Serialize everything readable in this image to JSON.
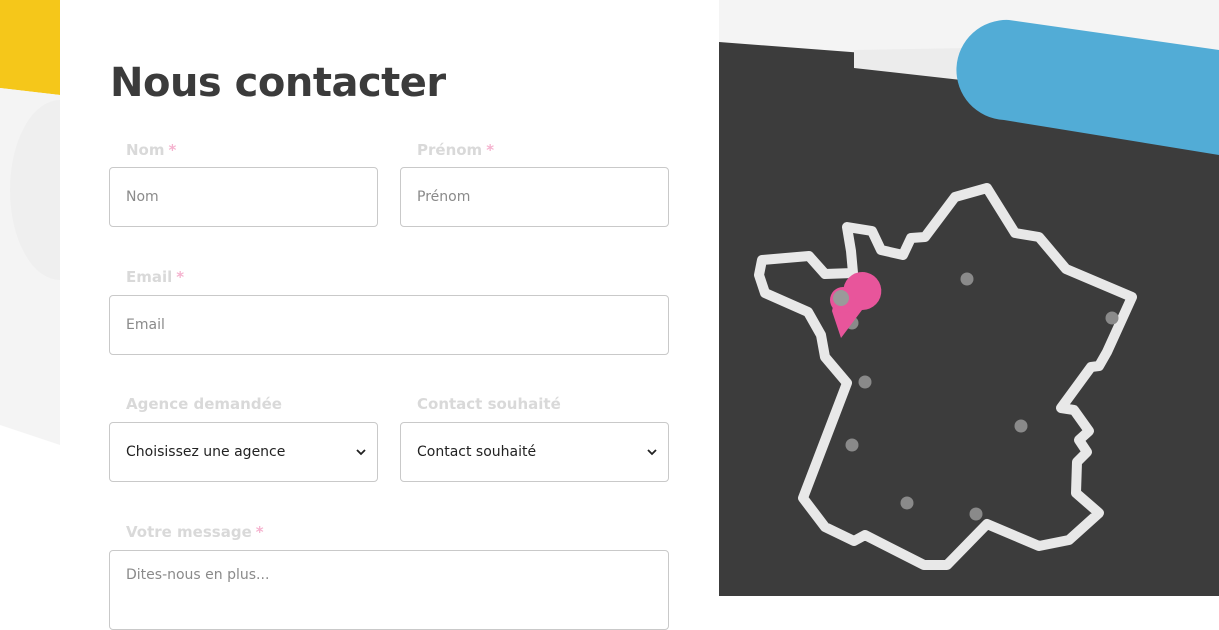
{
  "form": {
    "title": "Nous contacter",
    "required_mark": "*",
    "nom": {
      "label": "Nom",
      "placeholder": "Nom"
    },
    "prenom": {
      "label": "Prénom",
      "placeholder": "Prénom"
    },
    "email": {
      "label": "Email",
      "placeholder": "Email"
    },
    "agence": {
      "label": "Agence demandée",
      "value": "Choisissez une agence"
    },
    "contact": {
      "label": "Contact souhaité",
      "value": "Contact souhaité"
    },
    "message": {
      "label": "Votre message",
      "placeholder": "Dites-nous en plus..."
    }
  },
  "map": {
    "icon": "france-map-icon",
    "pin_icon": "location-pin-icon"
  },
  "colors": {
    "accent_yellow": "#f5c71a",
    "accent_blue": "#52acd6",
    "accent_pink": "#e8559b",
    "dark_panel": "#3c3c3c",
    "title_text": "#3b3b3b"
  }
}
